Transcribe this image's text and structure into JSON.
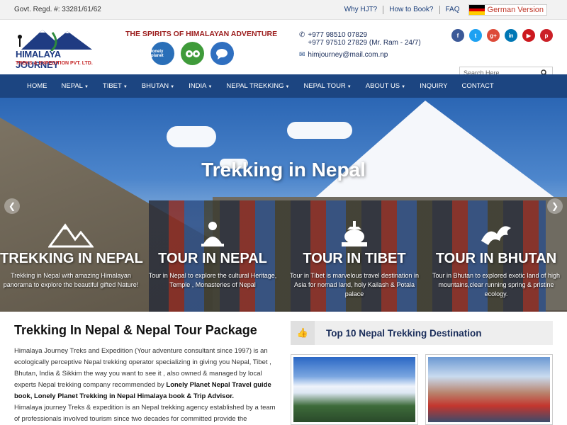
{
  "topbar": {
    "regd": "Govt. Regd. #: 33281/61/62",
    "links": [
      "Why HJT?",
      "How to Book?",
      "FAQ"
    ],
    "german": "German Version"
  },
  "header": {
    "logo_name": "HIMALAYA JOURNEY",
    "logo_sub": "TREKS & EXPEDITION PVT. LTD.",
    "tagline": "THE SPIRITS OF HIMALAYAN ADVENTURE",
    "badges": [
      "lonely planet",
      "tripadvisor",
      "chat"
    ],
    "phone1": "+977 98510 07829",
    "phone2": "+977 97510 27829 (Mr. Ram - 24/7)",
    "email": "himjourney@mail.com.np",
    "social": [
      "facebook",
      "twitter",
      "google-plus",
      "linkedin",
      "youtube",
      "pinterest"
    ],
    "search_placeholder": "Search Here..."
  },
  "nav": {
    "items": [
      "HOME",
      "NEPAL",
      "TIBET",
      "BHUTAN",
      "INDIA",
      "NEPAL TREKKING",
      "NEPAL TOUR",
      "ABOUT US",
      "INQUIRY",
      "CONTACT"
    ],
    "has_caret": [
      false,
      true,
      true,
      true,
      true,
      true,
      true,
      true,
      false,
      false
    ]
  },
  "hero": {
    "title": "Trekking in Nepal",
    "tiles": [
      {
        "title": "TREKKING IN NEPAL",
        "text": "Trekking in Nepal with amazing Himalayan panorama to explore the beautiful gifted Nature!"
      },
      {
        "title": "TOUR IN NEPAL",
        "text": "Tour in Nepal to explore the cultural Heritage, Temple , Monasteries of Nepal"
      },
      {
        "title": "TOUR IN TIBET",
        "text": "Tour in Tibet is marvelous travel destination in Asia for nomad land, holy Kailash & Potala palace"
      },
      {
        "title": "TOUR IN BHUTAN",
        "text": "Tour in Bhutan to explored exotic land of high mountains,clear running spring & pristine ecology."
      }
    ]
  },
  "content": {
    "heading": "Trekking In Nepal & Nepal Tour Package",
    "p1": "Himalaya Journey Treks and Expedition (Your adventure consultant since 1997) is an ecologically perceptive Nepal trekking operator specializing in giving you Nepal, Tibet , Bhutan, India & Sikkim the way you want to see it , also owned & managed by local experts Nepal trekking company recommended by ",
    "p1_bold": "Lonely Planet Nepal Travel guide book, Lonely Planet Trekking in Nepal Himalaya book & Trip Advisor.",
    "p2": "Himalaya journey Treks & expedition is an Nepal trekking agency established by a team of professionals involved tourism since two decades for committed provide the",
    "side_heading": "Top 10 Nepal Trekking Destination"
  },
  "colors": {
    "nav": "#1c4581",
    "accent_red": "#9b1b1b",
    "link": "#1a3e7a"
  }
}
